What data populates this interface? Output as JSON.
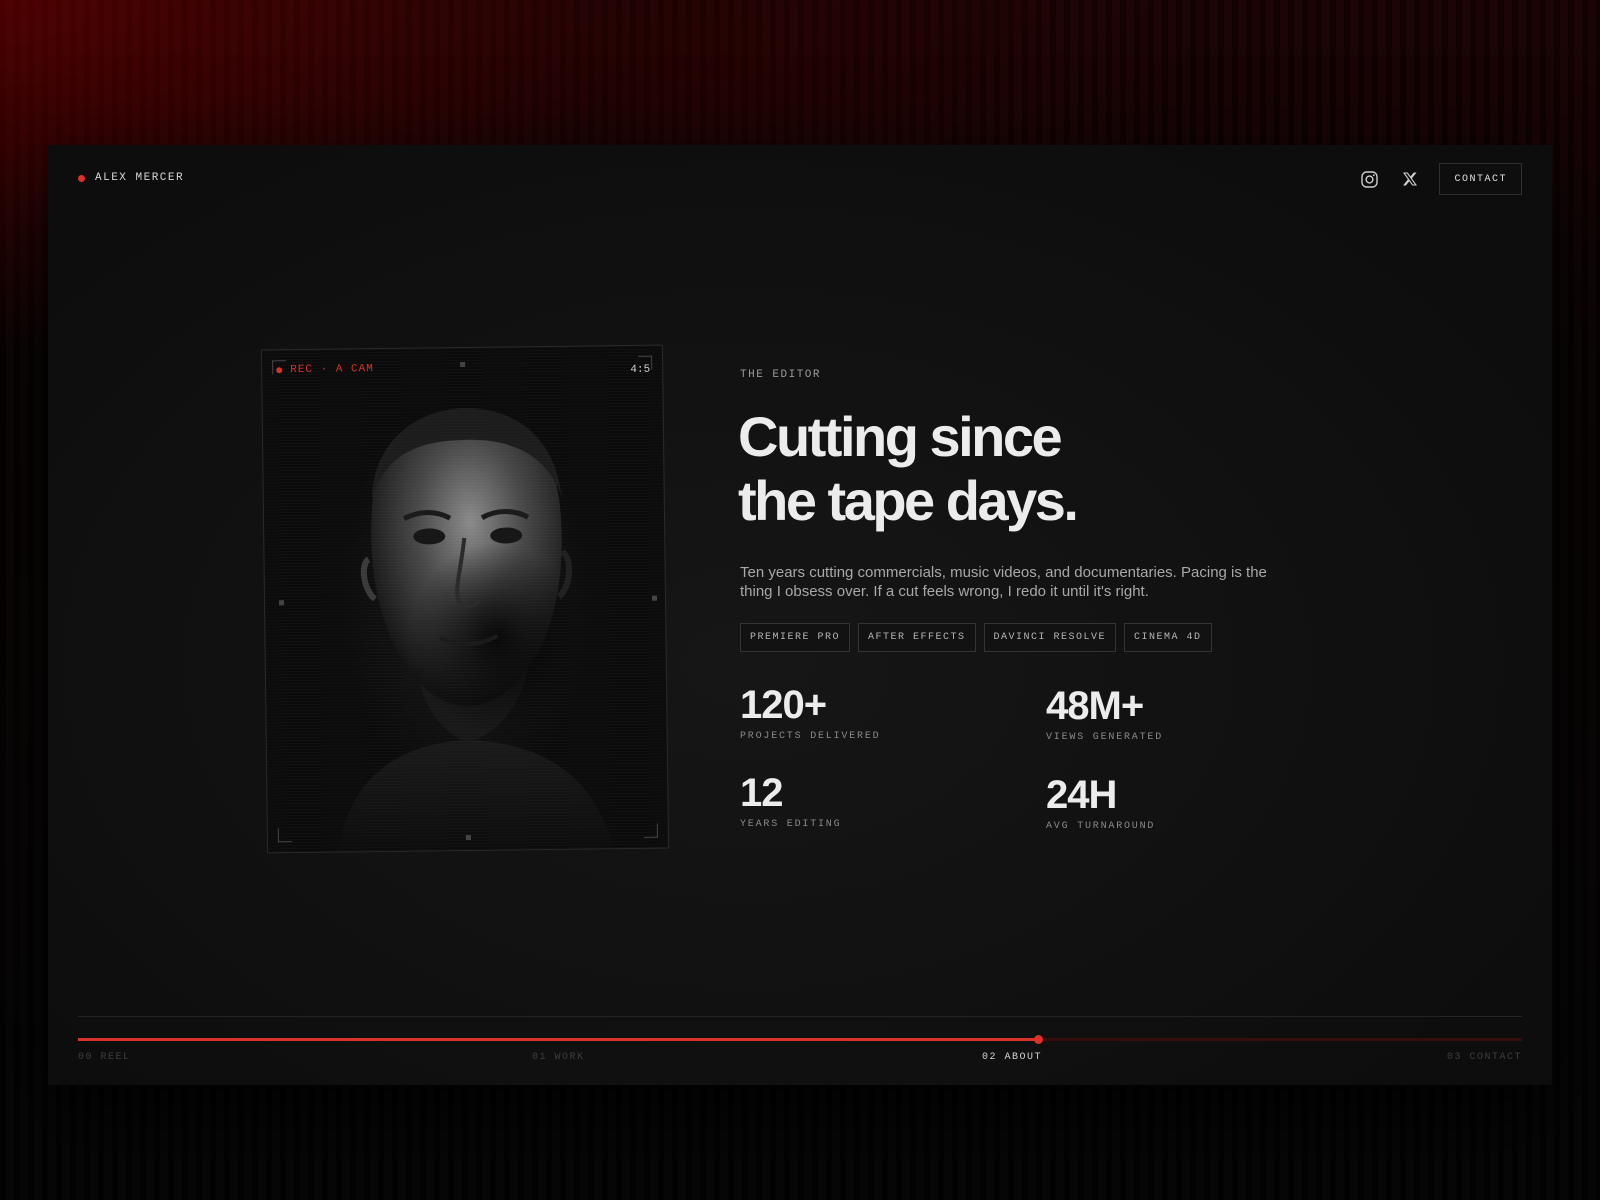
{
  "brand": {
    "name": "ALEX MERCER"
  },
  "nav": {
    "contact_label": "CONTACT",
    "icons": [
      "instagram-icon",
      "x-icon"
    ]
  },
  "frame": {
    "rec_label": "REC · A CAM",
    "ratio_label": "4:5"
  },
  "hero": {
    "eyebrow": "THE EDITOR",
    "headline_line1": "Cutting since",
    "headline_line2": "the tape days.",
    "bio": "Ten years cutting commercials, music videos, and documentaries. Pacing is the thing I obsess over. If a cut feels wrong, I redo it until it's right."
  },
  "tags": [
    "PREMIERE PRO",
    "AFTER EFFECTS",
    "DAVINCI RESOLVE",
    "CINEMA 4D"
  ],
  "stats": [
    {
      "value": "120+",
      "label": "PROJECTS DELIVERED"
    },
    {
      "value": "48M+",
      "label": "VIEWS GENERATED"
    },
    {
      "value": "12",
      "label": "YEARS EDITING"
    },
    {
      "value": "24H",
      "label": "AVG TURNAROUND"
    }
  ],
  "timeline": {
    "progress_percent": 66.5,
    "chapters": [
      {
        "label": "00 REEL",
        "active": false
      },
      {
        "label": "01 WORK",
        "active": false
      },
      {
        "label": "02 ABOUT",
        "active": true
      },
      {
        "label": "03 CONTACT",
        "active": false
      }
    ]
  },
  "colors": {
    "accent": "#d8332b",
    "background": "#101010",
    "text": "#ececec"
  }
}
